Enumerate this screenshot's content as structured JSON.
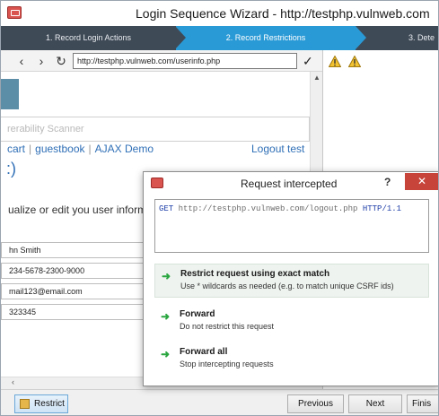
{
  "window": {
    "title": "Login Sequence Wizard - http://testphp.vulnweb.com"
  },
  "steps": [
    {
      "label": "1. Record Login Actions"
    },
    {
      "label": "2. Record Restrictions"
    },
    {
      "label": "3. Dete"
    }
  ],
  "browser": {
    "url": "http://testphp.vulnweb.com/userinfo.php",
    "back_icon": "chevron-left-icon",
    "forward_icon": "chevron-right-icon",
    "reload_icon": "reload-icon",
    "go_icon": "check-icon"
  },
  "page": {
    "scanner_text": "rerability Scanner",
    "menu": [
      "cart",
      "guestbook",
      "AJAX Demo"
    ],
    "logout": "Logout test",
    "paren": ":)",
    "intro": "ualize or edit you user informa",
    "fields": [
      "hn Smith",
      "234-5678-2300-9000",
      "mail123@email.com",
      "323345"
    ]
  },
  "dialog": {
    "title": "Request intercepted",
    "help": "?",
    "close": "✕",
    "request": {
      "method": "GET",
      "url": "http://testphp.vulnweb.com/logout.php",
      "protocol": "HTTP/1.1"
    },
    "options": [
      {
        "title": "Restrict request using exact match",
        "desc": "Use * wildcards as needed (e.g. to match unique CSRF ids)"
      },
      {
        "title": "Forward",
        "desc": "Do not restrict this request"
      },
      {
        "title": "Forward all",
        "desc": "Stop intercepting requests"
      }
    ]
  },
  "buttons": {
    "restrict": "Restrict",
    "previous": "Previous",
    "next": "Next",
    "finish": "Finis"
  },
  "colors": {
    "active_step": "#2a9ad6",
    "ribbon": "#3f4a57",
    "link": "#2f6fb6",
    "accent_green": "#2aa640",
    "close_red": "#c7443a"
  }
}
